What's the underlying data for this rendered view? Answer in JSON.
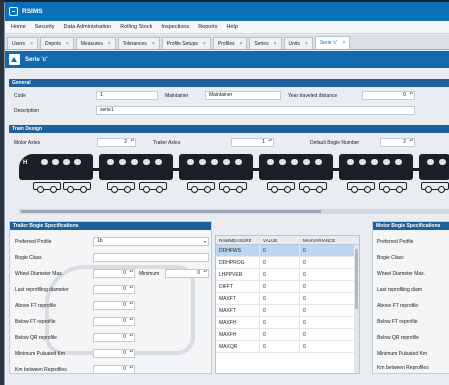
{
  "app": {
    "title": "RSIMS"
  },
  "menu": [
    "Home",
    "Security",
    "Data Administration",
    "Rolling Stock",
    "Inspections",
    "Reports",
    "Help"
  ],
  "tabs": [
    {
      "label": "Users",
      "active": false
    },
    {
      "label": "Depots",
      "active": false
    },
    {
      "label": "Measures",
      "active": false
    },
    {
      "label": "Tolerances",
      "active": false
    },
    {
      "label": "Profile Setups",
      "active": false
    },
    {
      "label": "Profiles",
      "active": false
    },
    {
      "label": "Series",
      "active": false
    },
    {
      "label": "Units",
      "active": false
    },
    {
      "label": "Serie 'c'",
      "active": true
    }
  ],
  "tab_close": "×",
  "doc": {
    "title": "Serie 'c'"
  },
  "general": {
    "header": "General",
    "code_label": "Code",
    "code_value": "1",
    "maintainer_label": "Maintainer",
    "maintainer_value": "Maintainer",
    "year_label": "Year traveled distance",
    "year_value": "0",
    "description_label": "Description",
    "description_value": "serie1"
  },
  "train_design": {
    "header": "Train Design",
    "motor_label": "Motor Axles",
    "motor_value": "2",
    "trailer_label": "Trailer Axles",
    "trailer_value": "1",
    "bogie_label": "Default Bogie Number",
    "bogie_value": "2",
    "lead_marker": "H"
  },
  "trailer_panel": {
    "header": "Trailer Bogie Specifications",
    "preferred_profile_label": "Preferred Profile",
    "preferred_profile_value": "1b",
    "bogie_class_label": "Bogie Class",
    "wheel_max_label": "Wheel Diameter Max.",
    "wheel_max_value": "0",
    "minimum_label": "Minimum",
    "minimum_value": "0",
    "last_reprofiling_label": "Last reprofiling diameter",
    "last_reprofiling_value": "0",
    "above_ft_label": "Above FT reprofile",
    "above_ft_value": "0",
    "below_ft_label": "Below FT reprofile",
    "below_ft_value": "0",
    "below_qr_label": "Below QR reprofile",
    "below_qr_value": "0",
    "minimum_pulsated_label": "Minimum Pulsated Km",
    "minimum_pulsated_value": "0",
    "km_between_label": "Km between Reprofiles",
    "km_between_value": "0"
  },
  "measures_grid": {
    "columns": [
      "RAWMEASURE",
      "VALUE",
      "MAXVARIANCE"
    ],
    "rows": [
      [
        "DDHFWS",
        "0",
        "0"
      ],
      [
        "DDHPROG",
        "0",
        "0"
      ],
      [
        "LHPPVER",
        "0",
        "0"
      ],
      [
        "DIFFT",
        "0",
        "0"
      ],
      [
        "MAXFT",
        "0",
        "0"
      ],
      [
        "MAXFT",
        "0",
        "0"
      ],
      [
        "MAXFH",
        "0",
        "0"
      ],
      [
        "MAXFH",
        "0",
        "0"
      ],
      [
        "MAXQR",
        "0",
        "0"
      ]
    ],
    "selected_row": 0
  },
  "motor_panel": {
    "header": "Motor Bogie Specifications",
    "labels": [
      "Preferred Profile",
      "Bogie Class",
      "Wheel Diameter Max.",
      "Last reprofiling diam",
      "Above FT reprofile",
      "Below FT reprofile",
      "Below QR reprofile",
      "Minimum Pulsated Km",
      "Km between Reprofiles"
    ]
  }
}
